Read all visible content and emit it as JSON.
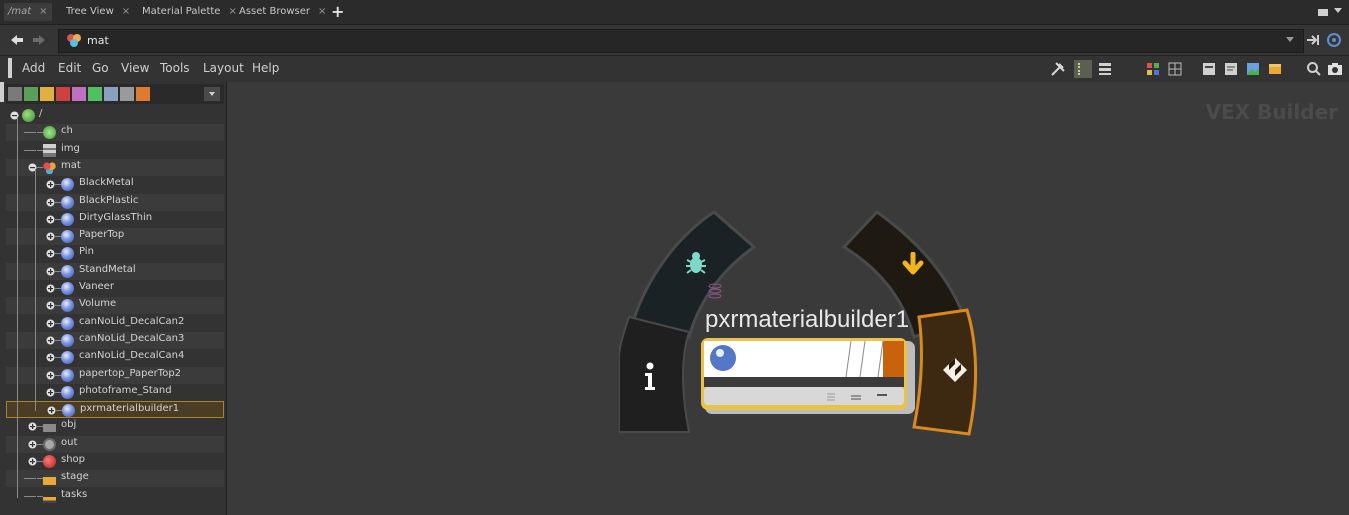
{
  "tabs": [
    {
      "label": "/mat",
      "active": true
    },
    {
      "label": "Tree View",
      "active": false
    },
    {
      "label": "Material Palette",
      "active": false
    },
    {
      "label": "Asset Browser",
      "active": false
    }
  ],
  "tab_close_glyph": "×",
  "tab_add_glyph": "+",
  "path": {
    "value": "mat"
  },
  "menu": [
    "Add",
    "Edit",
    "Go",
    "View",
    "Tools",
    "Layout",
    "Help"
  ],
  "tree": {
    "root": "/",
    "items": [
      {
        "label": "ch",
        "icon": "channel-icon"
      },
      {
        "label": "img",
        "icon": "composite-icon"
      },
      {
        "label": "mat",
        "icon": "material-network-icon"
      },
      {
        "label": "BlackMetal",
        "icon": "material-sphere-icon"
      },
      {
        "label": "BlackPlastic",
        "icon": "material-sphere-icon"
      },
      {
        "label": "DirtyGlassThin",
        "icon": "material-sphere-icon"
      },
      {
        "label": "PaperTop",
        "icon": "material-sphere-icon"
      },
      {
        "label": "Pin",
        "icon": "material-sphere-icon"
      },
      {
        "label": "StandMetal",
        "icon": "material-sphere-icon"
      },
      {
        "label": "Vaneer",
        "icon": "material-sphere-icon"
      },
      {
        "label": "Volume",
        "icon": "material-sphere-icon"
      },
      {
        "label": "canNoLid_DecalCan2",
        "icon": "material-sphere-icon"
      },
      {
        "label": "canNoLid_DecalCan3",
        "icon": "material-sphere-icon"
      },
      {
        "label": "canNoLid_DecalCan4",
        "icon": "material-sphere-icon"
      },
      {
        "label": "papertop_PaperTop2",
        "icon": "material-sphere-icon"
      },
      {
        "label": "photoframe_Stand",
        "icon": "material-sphere-icon"
      },
      {
        "label": "pxrmaterialbuilder1",
        "icon": "material-sphere-icon",
        "selected": true
      },
      {
        "label": "obj",
        "icon": "object-icon"
      },
      {
        "label": "out",
        "icon": "output-icon"
      },
      {
        "label": "shop",
        "icon": "shop-icon"
      },
      {
        "label": "stage",
        "icon": "stage-icon"
      },
      {
        "label": "tasks",
        "icon": "tasks-icon"
      }
    ]
  },
  "network": {
    "context_label": "VEX Builder",
    "node_name": "pxrmaterialbuilder1",
    "ring_icons": [
      "bug-icon",
      "download-arrow-icon",
      "info-icon",
      "checker-flag-icon"
    ]
  },
  "colors": {
    "accent_orange": "#d98a1a",
    "selection_yellow": "#e8c24a",
    "bug_teal": "#7fd8c8",
    "arrow_yellow": "#f2b51e"
  }
}
